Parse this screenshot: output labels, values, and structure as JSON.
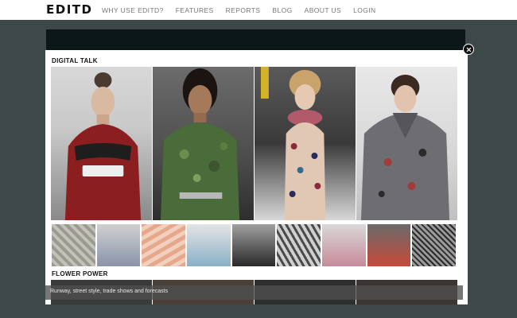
{
  "header": {
    "logo": "EDITD",
    "nav": [
      "WHY USE EDITD?",
      "FEATURES",
      "REPORTS",
      "BLOG",
      "ABOUT US",
      "LOGIN"
    ]
  },
  "modal": {
    "section1_title": "DIGITAL TALK",
    "section2_title": "FLOWER POWER",
    "caption": "Runway, street style, trade shows and forecasts"
  },
  "colors": {
    "page_bg": "#3e4848",
    "topbar_bg": "#ffffff",
    "modal_bg": "#ffffff"
  }
}
